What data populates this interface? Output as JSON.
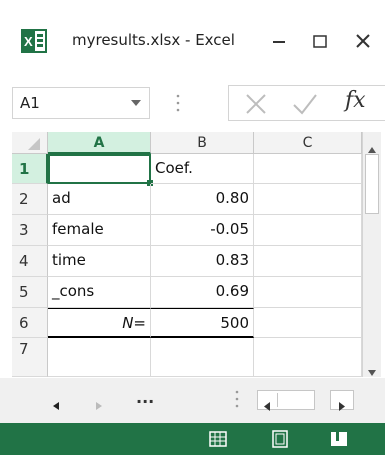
{
  "window": {
    "title": "myresults.xlsx - Excel",
    "icon": "excel-icon",
    "minimize_icon": "minimize-icon",
    "maximize_icon": "maximize-icon",
    "close_icon": "close-icon"
  },
  "formula_bar": {
    "name_box": "A1",
    "formula_label": "fx",
    "cancel_icon": "cancel-x-icon",
    "enter_icon": "checkmark-icon"
  },
  "grid": {
    "columns": [
      "A",
      "B",
      "C"
    ],
    "rows": [
      {
        "num": "1",
        "a": "",
        "b": "Coef."
      },
      {
        "num": "2",
        "a": "ad",
        "b": "0.80"
      },
      {
        "num": "3",
        "a": "female",
        "b": "-0.05"
      },
      {
        "num": "4",
        "a": "time",
        "b": "0.83"
      },
      {
        "num": "5",
        "a": "_cons",
        "b": "0.69"
      },
      {
        "num": "6",
        "a": "N=",
        "b": "500"
      },
      {
        "num": "7",
        "a": "",
        "b": ""
      }
    ],
    "selected_cell": "A1"
  },
  "sheet_nav": {
    "ellipsis": "...",
    "prev_icon": "triangle-left-icon",
    "next_icon": "triangle-right-icon"
  },
  "status_bar": {
    "color": "#217346",
    "view_icons": [
      "normal-view-icon",
      "page-layout-icon",
      "page-break-icon"
    ]
  },
  "colors": {
    "accent": "#217346",
    "selected_header": "#d3f0e0"
  }
}
